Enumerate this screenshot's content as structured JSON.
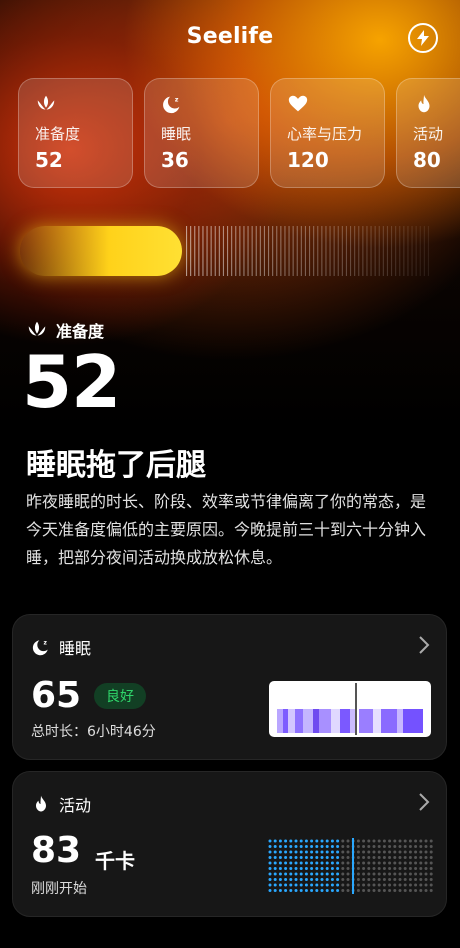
{
  "app": {
    "title": "Seelife"
  },
  "metrics": [
    {
      "icon": "lotus-icon",
      "label": "准备度",
      "value": "52"
    },
    {
      "icon": "moon-icon",
      "label": "睡眠",
      "value": "36"
    },
    {
      "icon": "heart-icon",
      "label": "心率与压力",
      "value": "120"
    },
    {
      "icon": "flame-icon",
      "label": "活动",
      "value": "80"
    }
  ],
  "readiness": {
    "section_label": "准备度",
    "score": "52",
    "headline": "睡眠拖了后腿",
    "description": "昨夜睡眠的时长、阶段、效率或节律偏离了你的常态，是今天准备度偏低的主要原因。今晚提前三十到六十分钟入睡，把部分夜间活动换成放松休息。"
  },
  "sleep_card": {
    "title": "睡眠",
    "score": "65",
    "badge": "良好",
    "total_duration": "总时长：6小时46分"
  },
  "activity_card": {
    "title": "活动",
    "score": "83",
    "unit": "千卡",
    "subtitle": "刚刚开始"
  },
  "colors": {
    "accent_yellow": "#ffd21a",
    "badge_green": "#2fd56a",
    "sleep_purple": "#8f72ff",
    "activity_blue": "#2aa8ff"
  }
}
